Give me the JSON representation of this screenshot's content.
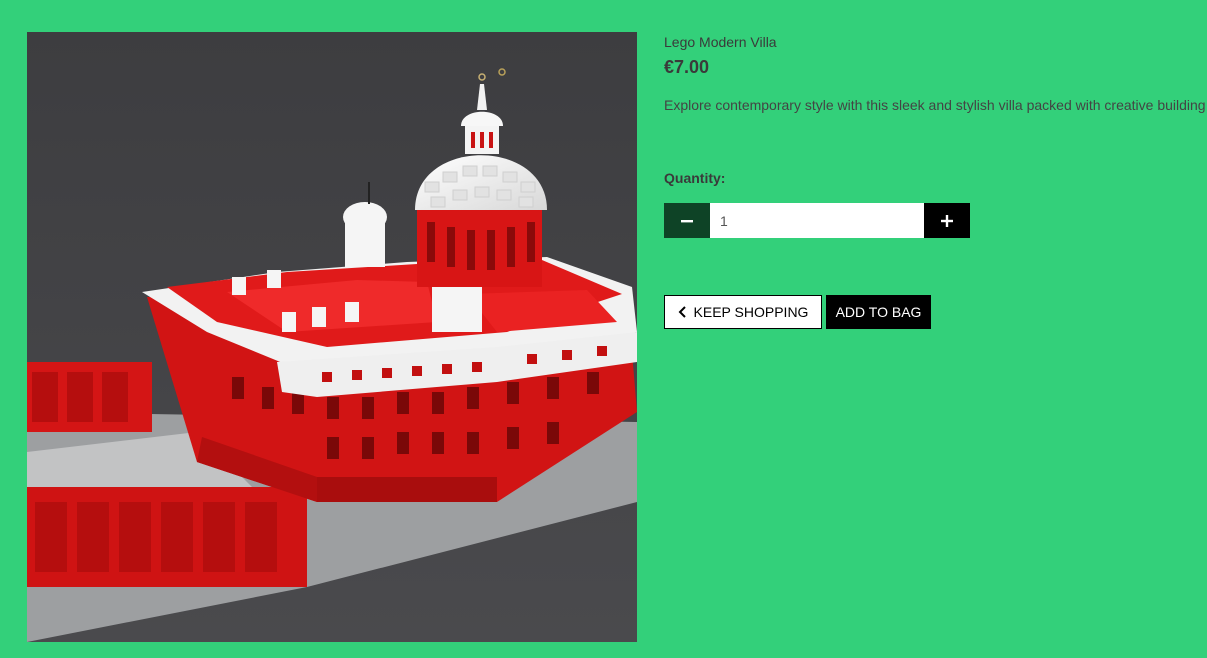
{
  "product": {
    "name": "Lego Modern Villa",
    "price": "€7.00",
    "description": "Explore contemporary style with this sleek and stylish villa packed with creative building options.",
    "image_alt": "Lego Modern Villa"
  },
  "quantity": {
    "label": "Quantity:",
    "value": "1"
  },
  "actions": {
    "keep_shopping_label": "KEEP SHOPPING",
    "add_to_bag_label": "ADD TO BAG"
  },
  "icons": {
    "minus": "minus-icon",
    "plus": "plus-icon",
    "back": "chevron-left-icon"
  },
  "colors": {
    "page_background": "#33d07a",
    "minus_button": "#0e4326",
    "plus_button": "#000000",
    "add_to_bag": "#000000"
  }
}
